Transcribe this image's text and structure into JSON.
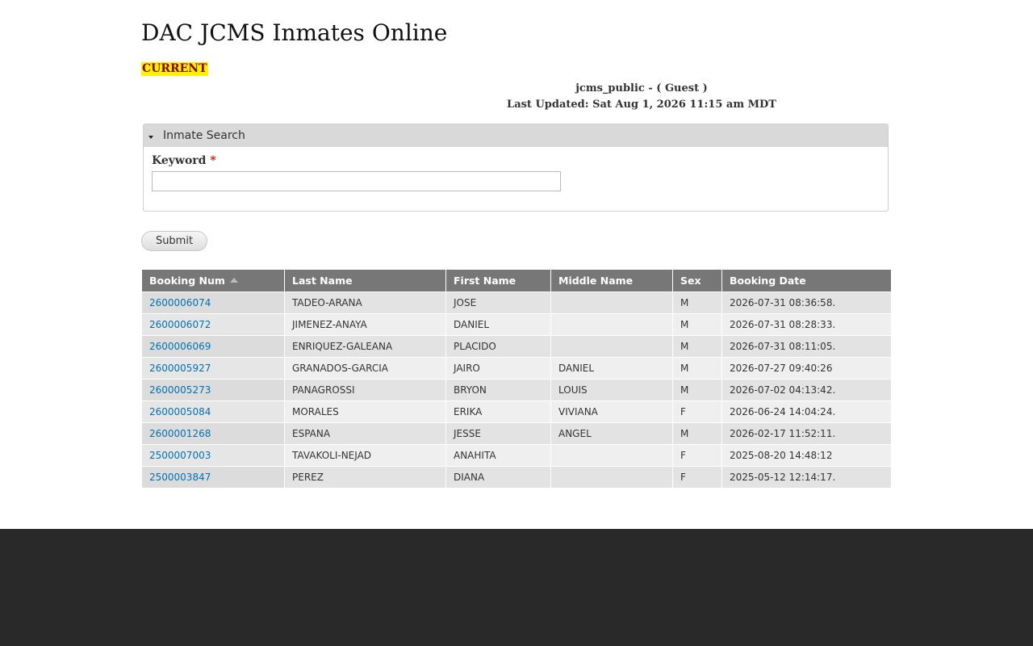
{
  "header": {
    "title": "DAC JCMS Inmates Online",
    "status": "CURRENT",
    "user": "jcms_public - ( Guest )",
    "last_updated": "Last Updated: Sat Aug 1, 2026 11:15 am MDT"
  },
  "search": {
    "legend": "Inmate Search",
    "keyword_label": "Keyword",
    "required_marker": "*",
    "keyword_value": "",
    "submit_label": "Submit"
  },
  "table": {
    "columns": [
      "Booking Num",
      "Last Name",
      "First Name",
      "Middle Name",
      "Sex",
      "Booking Date"
    ],
    "sorted_column": "Booking Num",
    "rows": [
      [
        "2600006074",
        "TADEO-ARANA",
        "JOSE",
        "",
        "M",
        "2026-07-31 08:36:58."
      ],
      [
        "2600006072",
        "JIMENEZ-ANAYA",
        "DANIEL",
        "",
        "M",
        "2026-07-31 08:28:33."
      ],
      [
        "2600006069",
        "ENRIQUEZ-GALEANA",
        "PLACIDO",
        "",
        "M",
        "2026-07-31 08:11:05."
      ],
      [
        "2600005927",
        "GRANADOS-GARCIA",
        "JAIRO",
        "DANIEL",
        "M",
        "2026-07-27 09:40:26"
      ],
      [
        "2600005273",
        "PANAGROSSI",
        "BRYON",
        "LOUIS",
        "M",
        "2026-07-02 04:13:42."
      ],
      [
        "2600005084",
        "MORALES",
        "ERIKA",
        "VIVIANA",
        "F",
        "2026-06-24 14:04:24."
      ],
      [
        "2600001268",
        "ESPANA",
        "JESSE",
        "ANGEL",
        "M",
        "2026-02-17 11:52:11."
      ],
      [
        "2500007003",
        "TAVAKOLI-NEJAD",
        "ANAHITA",
        "",
        "F",
        "2025-08-20 14:48:12"
      ],
      [
        "2500003847",
        "PEREZ",
        "DIANA",
        "",
        "F",
        "2025-05-12 12:14:17."
      ]
    ]
  },
  "colors": {
    "link": "#0071b3",
    "header_bg": "#777777",
    "footer_bg": "#292929",
    "status_bg": "#fff200",
    "status_text": "#8b0000"
  },
  "icons": {
    "legend_toggle": "triangle-down-icon",
    "sort": "sort-ascending-icon"
  }
}
